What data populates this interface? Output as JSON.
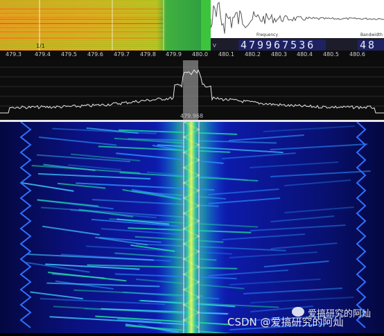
{
  "top_waterfall": {
    "fragment_label": "1/1"
  },
  "frequency_display": {
    "small_label": "V",
    "frequency_label": "Frequency",
    "frequency_digits": "479967536",
    "bandwidth_label": "Bandwidth",
    "bandwidth_digits": "48"
  },
  "frequency_scale": {
    "ticks": [
      "479.3",
      "479.4",
      "479.5",
      "479.6",
      "479.7",
      "479.8",
      "479.9",
      "480.0",
      "480.1",
      "480.2",
      "480.3",
      "480.4",
      "480.5",
      "480.6"
    ]
  },
  "spectrum": {
    "marker_label": "479.968"
  },
  "watermark": {
    "account_text": "爱搞研究的阿灿",
    "csdn_text": "CSDN @爱搞研究的阿灿"
  },
  "colors": {
    "waterfall_background": "#060a5a",
    "signal_core": "#f0ff60",
    "accent_green": "#3cc43c",
    "frequency_digits_bg": "#1e2260"
  }
}
